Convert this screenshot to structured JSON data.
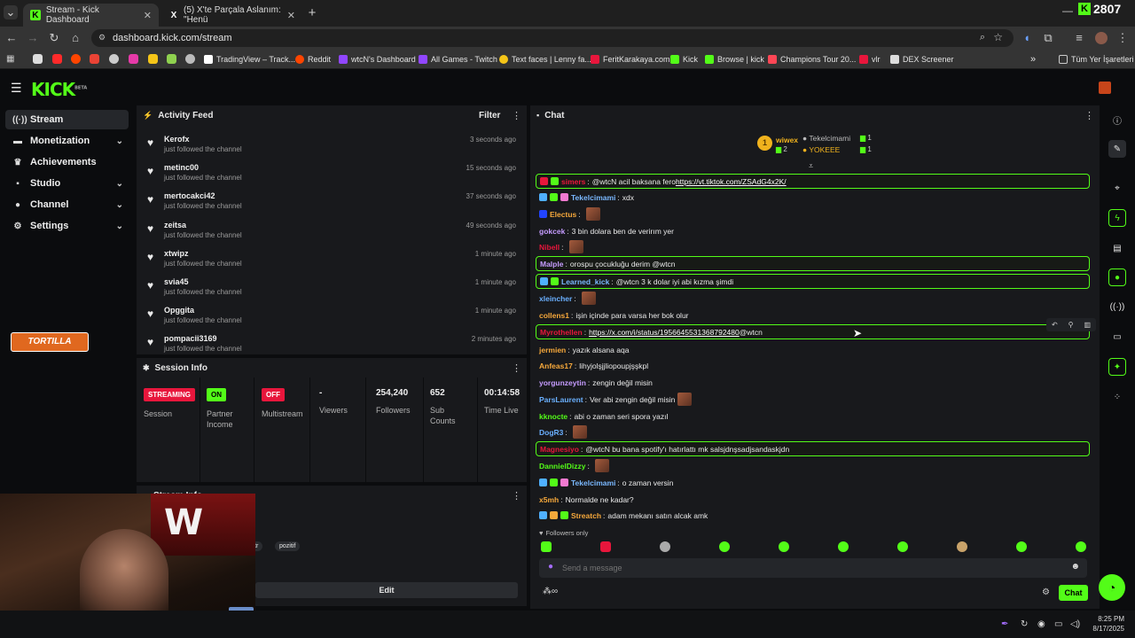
{
  "browser": {
    "tabs": [
      {
        "title": "Stream - Kick Dashboard",
        "icon": "kick-icon"
      },
      {
        "title": "(5) X'te Parçala Aslanım: \"Henü",
        "icon": "x-icon"
      }
    ],
    "new_tab": "+",
    "url": "dashboard.kick.com/stream",
    "top_right_number": "2807",
    "bookmarks": [
      "TradingView – Track...",
      "Reddit",
      "wtcN's Dashboard",
      "All Games - Twitch",
      "Text faces | Lenny fa...",
      "FeritKarakaya.com",
      "Kick",
      "Browse | kick",
      "Champions Tour 20...",
      "vlr",
      "DEX Screener"
    ],
    "bookmarks_more": "»",
    "all_bookmarks": "Tüm Yer İşaretleri"
  },
  "header": {
    "logo": "KICK",
    "logo_sup": "BETA"
  },
  "sidebar": {
    "items": [
      {
        "label": "Stream",
        "icon": "broadcast-icon",
        "active": true,
        "chevron": false
      },
      {
        "label": "Monetization",
        "icon": "wallet-icon",
        "chevron": true
      },
      {
        "label": "Achievements",
        "icon": "trophy-icon",
        "chevron": false
      },
      {
        "label": "Studio",
        "icon": "camera-icon",
        "chevron": true
      },
      {
        "label": "Channel",
        "icon": "user-icon",
        "chevron": true
      },
      {
        "label": "Settings",
        "icon": "gear-icon",
        "chevron": true
      }
    ],
    "overlay_logo": "TORTILLA"
  },
  "activity": {
    "title": "Activity Feed",
    "filter": "Filter",
    "items": [
      {
        "name": "Kerofx",
        "sub": "just followed the channel",
        "time": "3 seconds ago"
      },
      {
        "name": "metinc00",
        "sub": "just followed the channel",
        "time": "15 seconds ago"
      },
      {
        "name": "mertocakci42",
        "sub": "just followed the channel",
        "time": "37 seconds ago"
      },
      {
        "name": "zeitsa",
        "sub": "just followed the channel",
        "time": "49 seconds ago"
      },
      {
        "name": "xtwipz",
        "sub": "just followed the channel",
        "time": "1 minute ago"
      },
      {
        "name": "svia45",
        "sub": "just followed the channel",
        "time": "1 minute ago"
      },
      {
        "name": "Opggita",
        "sub": "just followed the channel",
        "time": "1 minute ago"
      },
      {
        "name": "pompacii3169",
        "sub": "just followed the channel",
        "time": "2 minutes ago"
      }
    ]
  },
  "session": {
    "title": "Session Info",
    "stats": [
      {
        "badge": "STREAMING",
        "label": "Session",
        "color": "#e8163c"
      },
      {
        "badge": "ON",
        "label": "Partner Income",
        "color": "#53fc18"
      },
      {
        "badge": "OFF",
        "label": "Multistream",
        "color": "#e8163c"
      },
      {
        "value": "-",
        "label": "Viewers"
      },
      {
        "value": "254,240",
        "label": "Followers"
      },
      {
        "value": "652",
        "label": "Sub Counts"
      },
      {
        "value": "00:14:58",
        "label": "Time Live"
      }
    ]
  },
  "streaminfo": {
    "title": "Stream Info",
    "tags": [
      "tr",
      "pozitif"
    ],
    "edit": "Edit"
  },
  "chat": {
    "title": "Chat",
    "leaderboard": [
      {
        "rank": "1",
        "name": "wiwex",
        "count": "2"
      },
      {
        "name": "Tekelcimami",
        "count": "1"
      },
      {
        "name": "YOKEEE",
        "count": "1"
      }
    ],
    "messages": [
      {
        "user": "simers",
        "color": "#e8163c",
        "text": "@wtcN acil baksana fero ",
        "link": "https://vt.tiktok.com/ZSAdG4x2K/",
        "hl": true,
        "badges": [
          "#e8163c",
          "#53fc18"
        ]
      },
      {
        "user": "Tekelcimami",
        "color": "#7ab8ff",
        "text": "xdx",
        "badges": [
          "#4fb0ff",
          "#53fc18",
          "#f27ad1"
        ]
      },
      {
        "user": "Electus",
        "color": "#f6a83b",
        "text": "",
        "emote": true,
        "badges": [
          "#2244ff"
        ]
      },
      {
        "user": "gokcek",
        "color": "#c69cff",
        "text": "3 bin dolara ben de verirım yer"
      },
      {
        "user": "Nibell",
        "color": "#e8163c",
        "text": "",
        "emote": true
      },
      {
        "user": "Malple",
        "color": "#c69cff",
        "text": "orospu çocukluğu derim @wtcn",
        "hl": true
      },
      {
        "user": "Learned_kick",
        "color": "#7ab8ff",
        "text": "@wtcn 3 k dolar iyi abi kızma şimdi",
        "hl": true,
        "badges": [
          "#4fb0ff",
          "#53fc18"
        ]
      },
      {
        "user": "xleincher",
        "color": "#6ab0ff",
        "text": "",
        "emote": true
      },
      {
        "user": "collens1",
        "color": "#f6a83b",
        "text": "işin içinde para varsa her bok olur"
      },
      {
        "user": "Myrothellen",
        "color": "#e8163c",
        "text": "",
        "link": "https://x.com/i/status/1956645531368792480",
        "after": " @wtcn",
        "hl": true
      },
      {
        "user": "jermien",
        "color": "#f6a83b",
        "text": "yazık alsana aqa"
      },
      {
        "user": "Anfeas17",
        "color": "#f6a83b",
        "text": "lihyjolşjjliopoupjşşkpl"
      },
      {
        "user": "yorgunzeytin",
        "color": "#c69cff",
        "text": "zengin değil misin"
      },
      {
        "user": "ParsLaurent",
        "color": "#6ab0ff",
        "text": "Ver abi zengin değil misin",
        "emote": true
      },
      {
        "user": "kknocte",
        "color": "#53fc18",
        "text": "abi o zaman seri spora yazıl"
      },
      {
        "user": "DogR3",
        "color": "#6ab0ff",
        "text": "",
        "emote": true
      },
      {
        "user": "Magnesiyo",
        "color": "#e8163c",
        "text": "@wtcN bu bana spotify'ı hatırlattı mk salsjdnşsadjsandaskjdn",
        "hl": true
      },
      {
        "user": "DannielDizzy",
        "color": "#53fc18",
        "text": "",
        "emote": true
      },
      {
        "user": "Tekelcimami",
        "color": "#7ab8ff",
        "text": "o zaman versin",
        "badges": [
          "#4fb0ff",
          "#53fc18",
          "#f27ad1"
        ]
      },
      {
        "user": "x5mh",
        "color": "#f6a83b",
        "text": "Normalde ne kadar?"
      },
      {
        "user": "Streatch",
        "color": "#f6a83b",
        "text": "adam mekanı satın alcak amk",
        "badges": [
          "#4fb0ff",
          "#f6a83b",
          "#53fc18"
        ]
      }
    ],
    "followers_only": "Followers only",
    "input_placeholder": "Send a message",
    "send": "Chat"
  },
  "taskbar": {
    "time": "8:25 PM",
    "date": "8/17/2025"
  },
  "colors": {
    "accent": "#53fc18",
    "panel": "#18191c",
    "bg": "#0b0c0e",
    "live": "#e8163c"
  }
}
